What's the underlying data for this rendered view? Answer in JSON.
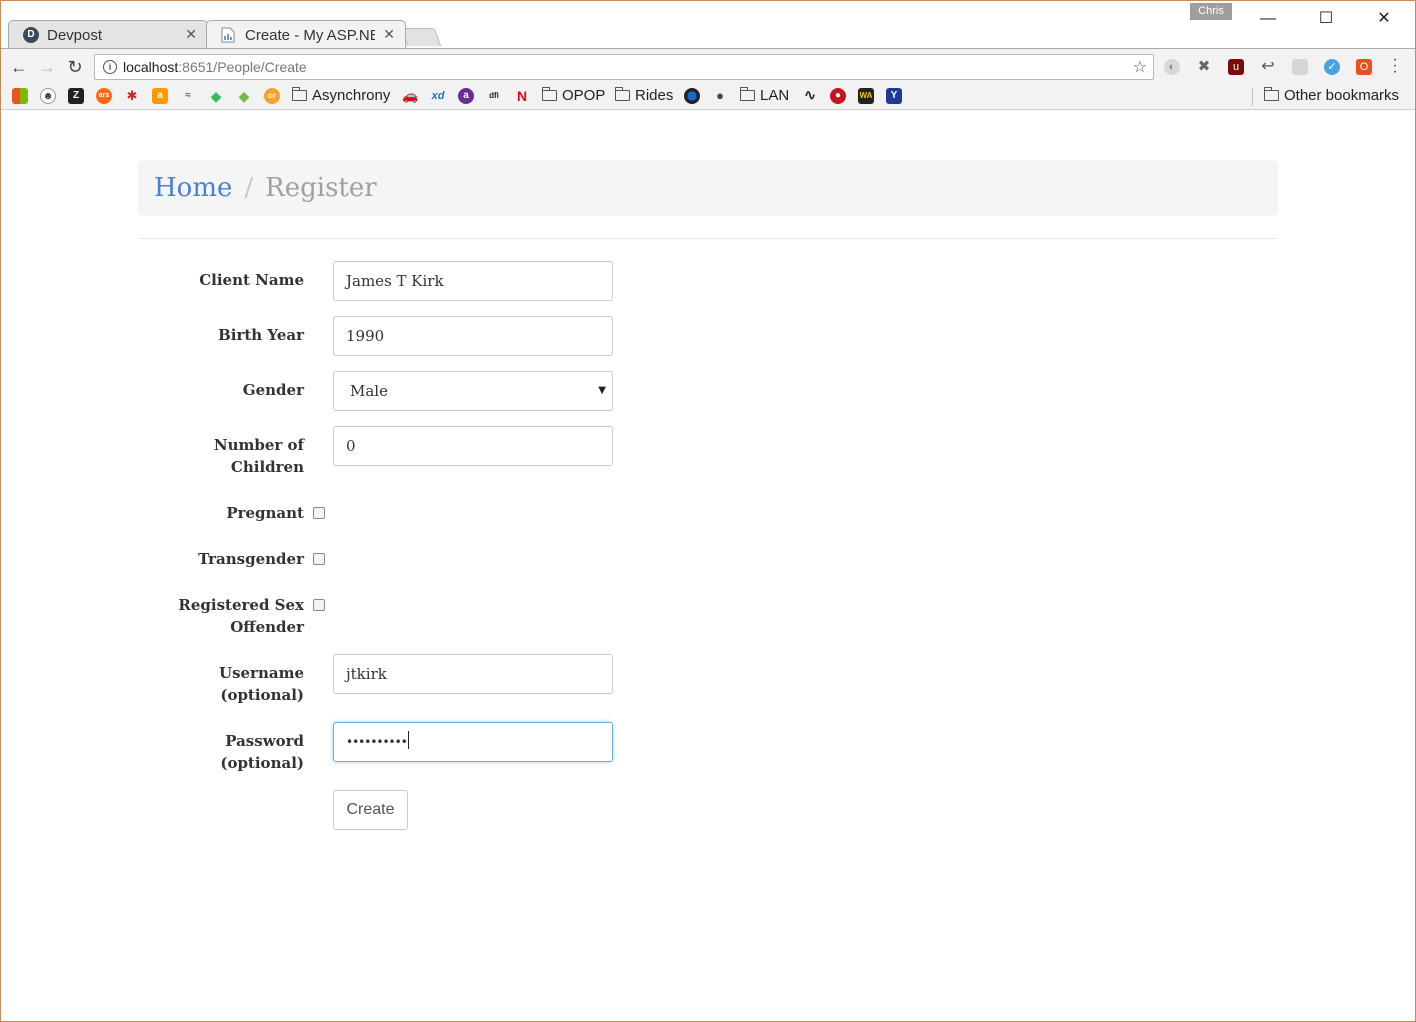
{
  "browser": {
    "profile_name": "Chris",
    "tabs": [
      {
        "title": "Devpost",
        "active": false,
        "favicon_letter": "D"
      },
      {
        "title": "Create - My ASP.NET",
        "active": true
      }
    ],
    "address": {
      "host": "localhost",
      "path": ":8651/People/Create"
    },
    "bookmarks": {
      "folders": [
        "Asynchrony",
        "OPOP",
        "Rides",
        "LAN"
      ],
      "other": "Other bookmarks"
    }
  },
  "page": {
    "breadcrumb": {
      "home": "Home",
      "separator": "/",
      "current": "Register"
    },
    "form": {
      "client_name": {
        "label": "Client Name",
        "value": "James T Kirk"
      },
      "birth_year": {
        "label": "Birth Year",
        "value": "1990"
      },
      "gender": {
        "label": "Gender",
        "selected": "Male"
      },
      "children": {
        "label_line1": "Number of",
        "label_line2": "Children",
        "value": "0"
      },
      "pregnant": {
        "label": "Pregnant",
        "checked": false
      },
      "transgender": {
        "label": "Transgender",
        "checked": false
      },
      "sex_offender": {
        "label_line1": "Registered Sex",
        "label_line2": "Offender",
        "checked": false
      },
      "username": {
        "label_line1": "Username",
        "label_line2": "(optional)",
        "value": "jtkirk"
      },
      "password": {
        "label_line1": "Password",
        "label_line2": "(optional)",
        "masked_value": "••••••••••"
      },
      "submit": "Create"
    }
  },
  "colors": {
    "link": "#4a7fd6",
    "focus": "#66afe9"
  }
}
